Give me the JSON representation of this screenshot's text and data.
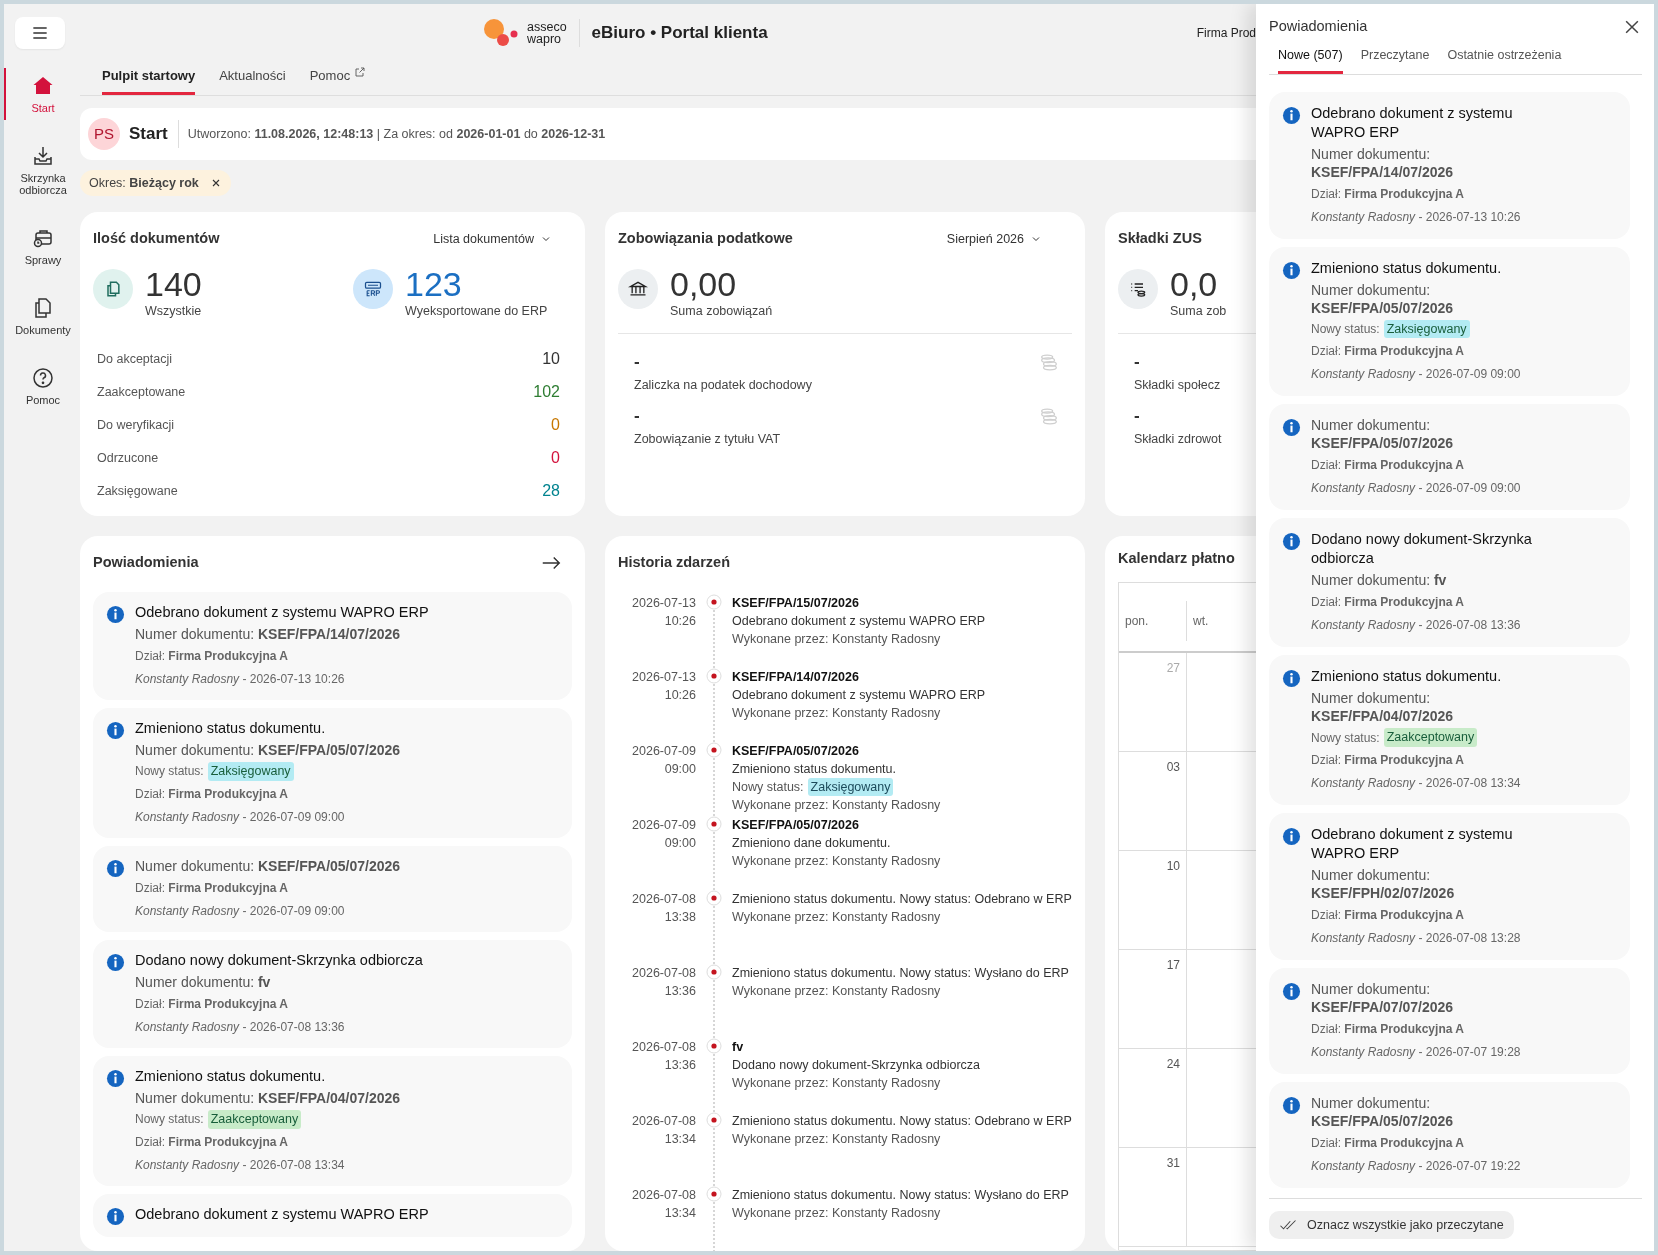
{
  "header": {
    "logo_lines": [
      "asseco",
      "wapro"
    ],
    "title": "eBiuro • Portal klienta",
    "company": "Firma Prod"
  },
  "nav": [
    {
      "label": "Start",
      "kind": "home",
      "selected": true
    },
    {
      "label": "Skrzynka odbiorcza",
      "kind": "inbox",
      "selected": false
    },
    {
      "label": "Sprawy",
      "kind": "cases",
      "selected": false
    },
    {
      "label": "Dokumenty",
      "kind": "docs",
      "selected": false
    },
    {
      "label": "Pomoc",
      "kind": "help",
      "selected": false
    }
  ],
  "tabs": [
    {
      "label": "Pulpit startowy",
      "selected": true,
      "external": false
    },
    {
      "label": "Aktualności",
      "selected": false,
      "external": false
    },
    {
      "label": "Pomoc",
      "selected": false,
      "external": true
    }
  ],
  "start": {
    "initials": "PS",
    "title": "Start",
    "meta": "Utworzono: **11.08.2026, 12:48:13** | Za okres: od **2026-01-01** do **2026-12-31**"
  },
  "filter_chip": "Okres: **Bieżący rok**",
  "documents_card": {
    "title": "Ilość dokumentów",
    "dropdown": "Lista dokumentów",
    "total": "140",
    "total_label": "Wszystkie",
    "exported": "123",
    "exported_label": "Wyeksportowane do ERP",
    "rows": [
      {
        "label": "Do akceptacji",
        "value": "10",
        "color": "#333333"
      },
      {
        "label": "Zaakceptowane",
        "value": "102",
        "color": "#2e7d32"
      },
      {
        "label": "Do weryfikacji",
        "value": "0",
        "color": "#c77700"
      },
      {
        "label": "Odrzucone",
        "value": "0",
        "color": "#d3123c"
      },
      {
        "label": "Zaksięgowane",
        "value": "28",
        "color": "#00838f"
      }
    ]
  },
  "tax_card": {
    "title": "Zobowiązania podatkowe",
    "dropdown": "Sierpień 2026",
    "sum": "0,00",
    "sum_label": "Suma zobowiązań",
    "rows": [
      {
        "value": "-",
        "label": "Zaliczka na podatek dochodowy"
      },
      {
        "value": "-",
        "label": "Zobowiązanie z tytułu VAT"
      }
    ]
  },
  "zus_card": {
    "title": "Składki ZUS",
    "sum": "0,0",
    "sum_label": "Suma zob",
    "rows": [
      {
        "value": "-",
        "label": "Składki społecz"
      },
      {
        "value": "-",
        "label": "Składki zdrowot"
      }
    ]
  },
  "notifications_card": {
    "title": "Powiadomienia",
    "items": [
      {
        "title": "Odebrano dokument z systemu WAPRO ERP",
        "number": "Numer dokumentu: **KSEF/FPA/14/07/2026**",
        "dept": "Dział: **Firma Produkcyjna A**",
        "author": "*Konstanty Radosny* - 2026-07-13 10:26"
      },
      {
        "title": "Zmieniono status dokumentu.",
        "number": "Numer dokumentu: **KSEF/FPA/05/07/2026**",
        "status_label": "Nowy status:",
        "status": "Zaksięgowany",
        "color": "#b3ebf3",
        "dept": "Dział: **Firma Produkcyjna A**",
        "author": "*Konstanty Radosny* - 2026-07-09 09:00"
      },
      {
        "number": "Numer dokumentu: **KSEF/FPA/05/07/2026**",
        "dept": "Dział: **Firma Produkcyjna A**",
        "author": "*Konstanty Radosny* - 2026-07-09 09:00"
      },
      {
        "title": "Dodano nowy dokument-Skrzynka odbiorcza",
        "number": "Numer dokumentu: **fv**",
        "dept": "Dział: **Firma Produkcyjna A**",
        "author": "*Konstanty Radosny* - 2026-07-08 13:36"
      },
      {
        "title": "Zmieniono status dokumentu.",
        "number": "Numer dokumentu: **KSEF/FPA/04/07/2026**",
        "status_label": "Nowy status:",
        "status": "Zaakceptowany",
        "color": "#c8ebc9",
        "dept": "Dział: **Firma Produkcyjna A**",
        "author": "*Konstanty Radosny* - 2026-07-08 13:34"
      },
      {
        "title": "Odebrano dokument z systemu WAPRO ERP"
      }
    ]
  },
  "history": {
    "title": "Historia zdarzeń",
    "items": [
      {
        "date": "2026-07-13",
        "time": "10:26",
        "doc": "KSEF/FPA/15/07/2026",
        "text": "Odebrano dokument z systemu WAPRO ERP",
        "by": "Wykonane przez: Konstanty Radosny"
      },
      {
        "date": "2026-07-13",
        "time": "10:26",
        "doc": "KSEF/FPA/14/07/2026",
        "text": "Odebrano dokument z systemu WAPRO ERP",
        "by": "Wykonane przez: Konstanty Radosny"
      },
      {
        "date": "2026-07-09",
        "time": "09:00",
        "doc": "KSEF/FPA/05/07/2026",
        "text": "Zmieniono status dokumentu.",
        "status_label": "Nowy status:",
        "status": "Zaksięgowany",
        "color": "#b3ebf3",
        "by": "Wykonane przez: Konstanty Radosny"
      },
      {
        "date": "2026-07-09",
        "time": "09:00",
        "doc": "KSEF/FPA/05/07/2026",
        "text": "Zmieniono dane dokumentu.",
        "by": "Wykonane przez: Konstanty Radosny"
      },
      {
        "date": "2026-07-08",
        "time": "13:38",
        "text": "Zmieniono status dokumentu. Nowy status: Odebrano w ERP",
        "by": "Wykonane przez: Konstanty Radosny"
      },
      {
        "date": "2026-07-08",
        "time": "13:36",
        "text": "Zmieniono status dokumentu. Nowy status: Wysłano do ERP",
        "by": "Wykonane przez: Konstanty Radosny"
      },
      {
        "date": "2026-07-08",
        "time": "13:36",
        "doc": "fv",
        "text": "Dodano nowy dokument-Skrzynka odbiorcza",
        "by": "Wykonane przez: Konstanty Radosny"
      },
      {
        "date": "2026-07-08",
        "time": "13:34",
        "text": "Zmieniono status dokumentu. Nowy status: Odebrano w ERP",
        "by": "Wykonane przez: Konstanty Radosny"
      },
      {
        "date": "2026-07-08",
        "time": "13:34",
        "text": "Zmieniono status dokumentu. Nowy status: Wysłano do ERP",
        "by": "Wykonane przez: Konstanty Radosny"
      }
    ]
  },
  "calendar": {
    "title": "Kalendarz płatno",
    "weekdays": [
      "pon.",
      "wt."
    ],
    "weeks": [
      {
        "day": "27",
        "muted": true
      },
      {
        "day": "03",
        "muted": false
      },
      {
        "day": "10",
        "muted": false
      },
      {
        "day": "17",
        "muted": false
      },
      {
        "day": "24",
        "muted": false
      },
      {
        "day": "31",
        "muted": false
      }
    ]
  },
  "panel": {
    "title": "Powiadomienia",
    "tabs": [
      {
        "label": "Nowe (507)",
        "selected": true
      },
      {
        "label": "Przeczytane",
        "selected": false
      },
      {
        "label": "Ostatnie ostrzeżenia",
        "selected": false
      }
    ],
    "items": [
      {
        "title": "Odebrano dokument z systemu WAPRO ERP",
        "number": "Numer dokumentu: **KSEF/FPA/14/07/2026**",
        "dept": "Dział: **Firma Produkcyjna A**",
        "author": "*Konstanty Radosny* - 2026-07-13 10:26"
      },
      {
        "title": "Zmieniono status dokumentu.",
        "number": "Numer dokumentu: **KSEF/FPA/05/07/2026**",
        "status_label": "Nowy status:",
        "status": "Zaksięgowany",
        "color": "#b3ebf3",
        "dept": "Dział: **Firma Produkcyjna A**",
        "author": "*Konstanty Radosny* - 2026-07-09 09:00"
      },
      {
        "number": "Numer dokumentu: **KSEF/FPA/05/07/2026**",
        "dept": "Dział: **Firma Produkcyjna A**",
        "author": "*Konstanty Radosny* - 2026-07-09 09:00"
      },
      {
        "title": "Dodano nowy dokument-Skrzynka odbiorcza",
        "number": "Numer dokumentu: **fv**",
        "dept": "Dział: **Firma Produkcyjna A**",
        "author": "*Konstanty Radosny* - 2026-07-08 13:36"
      },
      {
        "title": "Zmieniono status dokumentu.",
        "number": "Numer dokumentu: **KSEF/FPA/04/07/2026**",
        "status_label": "Nowy status:",
        "status": "Zaakceptowany",
        "color": "#c8ebc9",
        "dept": "Dział: **Firma Produkcyjna A**",
        "author": "*Konstanty Radosny* - 2026-07-08 13:34"
      },
      {
        "title": "Odebrano dokument z systemu WAPRO ERP",
        "number": "Numer dokumentu: **KSEF/FPH/02/07/2026**",
        "dept": "Dział: **Firma Produkcyjna A**",
        "author": "*Konstanty Radosny* - 2026-07-08 13:28"
      },
      {
        "number": "Numer dokumentu: **KSEF/FPA/07/07/2026**",
        "dept": "Dział: **Firma Produkcyjna A**",
        "author": "*Konstanty Radosny* - 2026-07-07 19:28"
      },
      {
        "number": "Numer dokumentu: **KSEF/FPA/05/07/2026**",
        "dept": "Dział: **Firma Produkcyjna A**",
        "author": "*Konstanty Radosny* - 2026-07-07 19:22"
      }
    ],
    "mark_all": "Oznacz wszystkie jako przeczytane"
  }
}
